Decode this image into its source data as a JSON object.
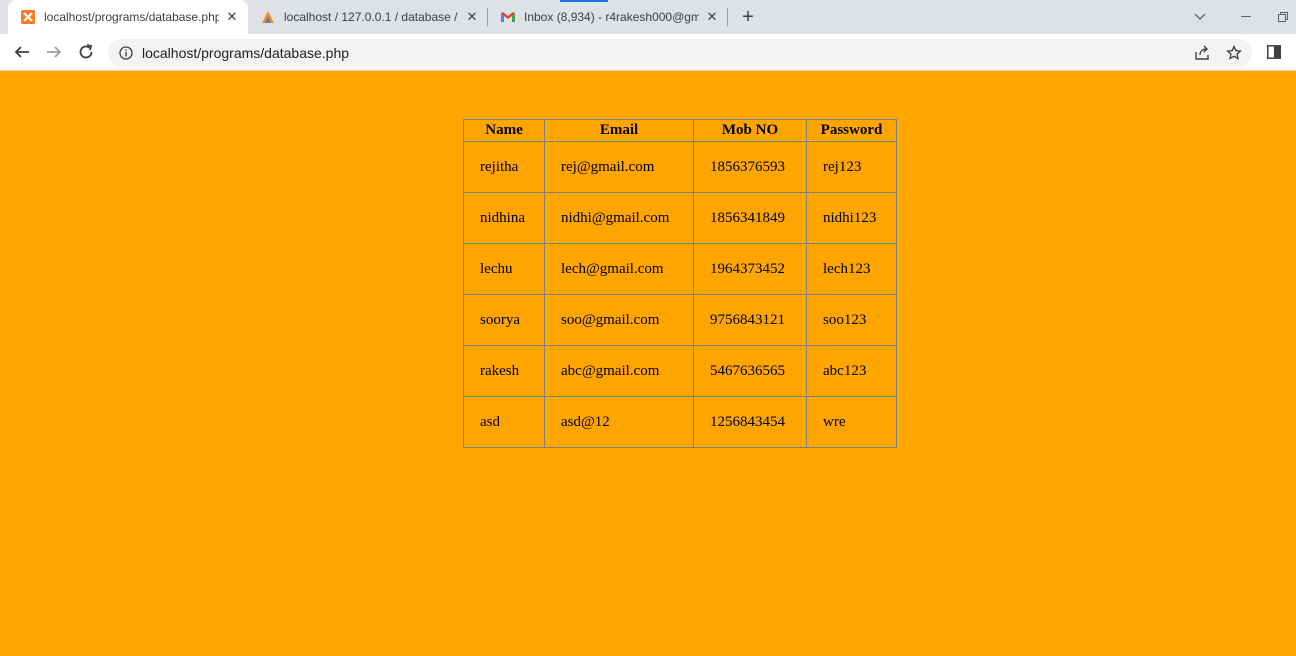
{
  "browser": {
    "tabs": [
      {
        "title": "localhost/programs/database.php",
        "icon": "xampp-icon",
        "active": true
      },
      {
        "title": "localhost / 127.0.0.1 / database /",
        "icon": "phpmyadmin-icon",
        "active": false
      },
      {
        "title": "Inbox (8,934) - r4rakesh000@gm",
        "icon": "gmail-icon",
        "active": false
      }
    ],
    "address": "localhost/programs/database.php"
  },
  "page": {
    "background_color": "#ffa500",
    "table": {
      "headers": [
        "Name",
        "Email",
        "Mob NO",
        "Password"
      ],
      "rows": [
        [
          "rejitha",
          "rej@gmail.com",
          "1856376593",
          "rej123"
        ],
        [
          "nidhina",
          "nidhi@gmail.com",
          "1856341849",
          "nidhi123"
        ],
        [
          "lechu",
          "lech@gmail.com",
          "1964373452",
          "lech123"
        ],
        [
          "soorya",
          "soo@gmail.com",
          "9756843121",
          "soo123"
        ],
        [
          "rakesh",
          "abc@gmail.com",
          "5467636565",
          "abc123"
        ],
        [
          "asd",
          "asd@12",
          "1256843454",
          "wre"
        ]
      ]
    }
  }
}
